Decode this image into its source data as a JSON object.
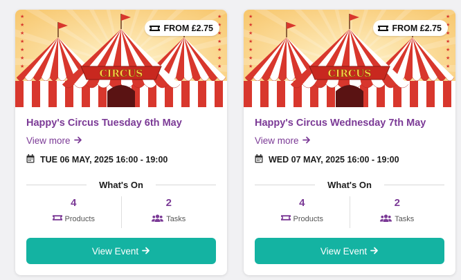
{
  "colors": {
    "accent": "#7b3a96",
    "button": "#14b3a2"
  },
  "events": [
    {
      "price_label": "FROM £2.75",
      "image_sign_text": "CIRCUS",
      "title": "Happy's Circus Tuesday 6th May",
      "view_more_label": "View more",
      "date_text": "TUE 06 MAY, 2025 16:00 - 19:00",
      "whats_on_label": "What's On",
      "products_count": "4",
      "products_label": "Products",
      "tasks_count": "2",
      "tasks_label": "Tasks",
      "button_label": "View Event"
    },
    {
      "price_label": "FROM £2.75",
      "image_sign_text": "CIRCUS",
      "title": "Happy's Circus Wednesday 7th May",
      "view_more_label": "View more",
      "date_text": "WED 07 MAY, 2025 16:00 - 19:00",
      "whats_on_label": "What's On",
      "products_count": "4",
      "products_label": "Products",
      "tasks_count": "2",
      "tasks_label": "Tasks",
      "button_label": "View Event"
    }
  ]
}
